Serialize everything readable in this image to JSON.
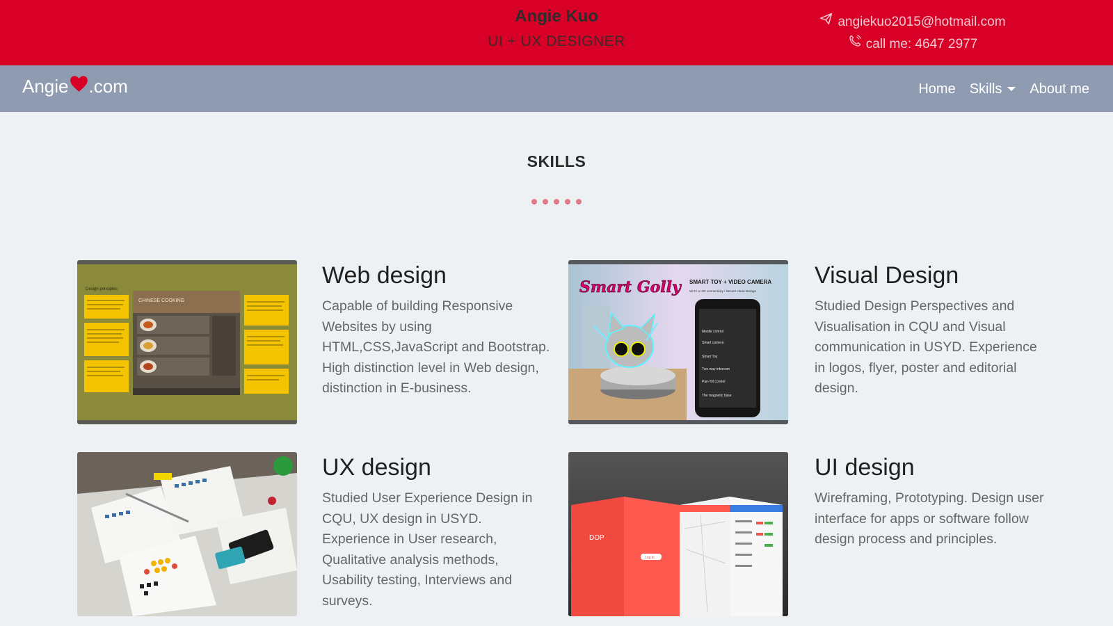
{
  "header": {
    "name": "Angie Kuo",
    "role": "UI + UX DESIGNER",
    "email": "angiekuo2015@hotmail.com",
    "phone": "call me: 4647 2977",
    "email_icon": "paper-plane-icon",
    "phone_icon": "phone-icon",
    "bg_color": "#d80027"
  },
  "nav": {
    "logo_prefix": "Angie",
    "logo_suffix": ".com",
    "logo_icon": "heart-icon",
    "links": [
      "Home",
      "Skills",
      "About me"
    ],
    "bg_color": "#8f9bb0"
  },
  "skills": {
    "title": "SKILLS",
    "dot_count": 5,
    "items": [
      {
        "title": "Web design",
        "desc": "Capable of building Responsive Websites by using HTML,CSS,JavaScript and Bootstrap. High distinction level in Web design, distinction in E-business.",
        "image": {
          "left_panel_title": "Design principles",
          "center_title": "CHINESE COOKING"
        }
      },
      {
        "title": "Visual Design",
        "desc": "Studied Design Perspectives and Visualisation in CQU and Visual communication in USYD. Experience in logos, flyer, poster and editorial design.",
        "image": {
          "logo_text": "Smart Golly",
          "headline": "SMART TOY + VIDEO CAMERA",
          "subline": "Wi-Fi or 4G connectivity / Secure cloud storage",
          "features": [
            "Mobile control",
            "Smart camera",
            "Smart Toy",
            "Two way intercom",
            "Pan-Tilt control",
            "The magnetic base"
          ]
        }
      },
      {
        "title": "UX design",
        "desc": "Studied User Experience Design in CQU, UX design in USYD. Experience in User research, Qualitative analysis methods, Usability testing, Interviews and surveys.",
        "image": {}
      },
      {
        "title": "UI design",
        "desc": "Wireframing, Prototyping. Design user interface for apps or software follow design process and principles.",
        "image": {
          "app_name": "DOP",
          "button_label": "Log in"
        }
      }
    ]
  }
}
